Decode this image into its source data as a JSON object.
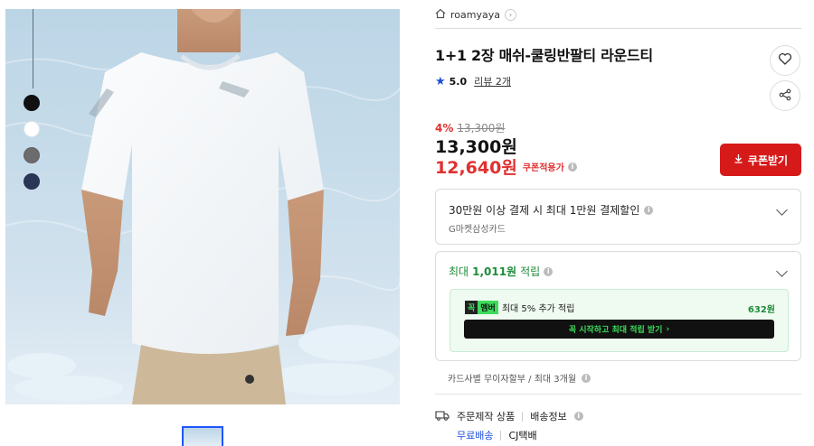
{
  "product": {
    "color_swatches": [
      {
        "name": "black",
        "color": "#111111"
      },
      {
        "name": "white",
        "color": "#ffffff"
      },
      {
        "name": "gray",
        "color": "#6c6c6c"
      },
      {
        "name": "navy",
        "color": "#2b3556"
      }
    ]
  },
  "store": {
    "name": "roamyaya",
    "chevron": "›"
  },
  "title": "1+1 2장 매쉬-쿨링반팔티 라운드티",
  "rating": {
    "star": "★",
    "score": "5.0",
    "review_label": "리뷰 2개"
  },
  "pricing": {
    "discount_pct": "4%",
    "original_price": "13,300원",
    "price": "13,300원",
    "coupon_price": "12,640원",
    "coupon_applied_label": "쿠폰적용가",
    "coupon_button": "쿠폰받기"
  },
  "card_discount": {
    "title": "30만원 이상 결제 시 최대 1만원 결제할인",
    "subtitle": "G마켓삼성카드"
  },
  "points": {
    "prefix": "최대",
    "amount": "1,011원",
    "suffix": "적립",
    "member_badge_a": "꼭",
    "member_badge_b": "멤버",
    "member_text": "최대 5% 추가 적립",
    "member_amount": "632원",
    "member_cta": "꼭 시작하고 최대 적립 받기",
    "cta_arrow": "›"
  },
  "installment": "카드사별 무이자할부 / 최대 3개월",
  "shipping": {
    "label_order": "주문제작 상품",
    "label_info": "배송정보",
    "free": "무료배송",
    "carrier": "CJ택배"
  },
  "icons": {
    "info": "i",
    "heart": "heart-icon",
    "share": "share-icon",
    "download": "download-icon",
    "truck": "truck-icon",
    "home": "home-icon"
  },
  "colors": {
    "accent_red": "#d61a1a",
    "price_red": "#e03131",
    "points_green": "#1e8c3a",
    "star_blue": "#1c4fd8"
  }
}
